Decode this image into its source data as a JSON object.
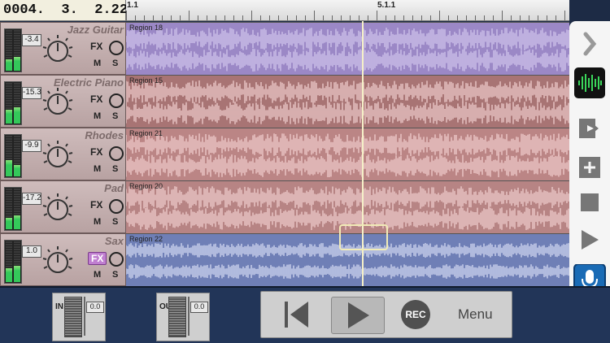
{
  "counter": "0004.  3.  2.221",
  "ruler": {
    "labels": [
      "1.1",
      "5.1.1"
    ]
  },
  "tracks": [
    {
      "name": "Jazz Guitar",
      "volume": "-3.4",
      "region": "Region 18",
      "color": "#9b88c6",
      "fx_active": false
    },
    {
      "name": "Electric Piano",
      "volume": "-15.3",
      "region": "Region 15",
      "color": "#a87474",
      "fx_active": false
    },
    {
      "name": "Rhodes",
      "volume": "-9.9",
      "region": "Region 21",
      "color": "#bb8585",
      "fx_active": false
    },
    {
      "name": "Pad",
      "volume": "-17.2",
      "region": "Region 20",
      "color": "#b78484",
      "fx_active": false
    },
    {
      "name": "Sax",
      "volume": "1.0",
      "region": "Region 22",
      "color": "#6f7fb6",
      "fx_active": true
    }
  ],
  "track_controls": {
    "fx": "FX",
    "mute": "M",
    "solo": "S"
  },
  "right_panel": {
    "icons": [
      "chevron-right-icon",
      "waveform-icon",
      "import-icon",
      "add-track-icon",
      "stop-icon",
      "play-icon",
      "microphone-icon"
    ]
  },
  "io": {
    "in_label": "IN",
    "in_value": "0.0",
    "out_label": "OUT",
    "out_value": "0.0"
  },
  "transport": {
    "rec_label": "REC",
    "menu_label": "Menu"
  },
  "colors": {
    "accent_green": "#3ad65a",
    "playhead": "#f5f0c8",
    "bottom_bg": "#223558"
  }
}
